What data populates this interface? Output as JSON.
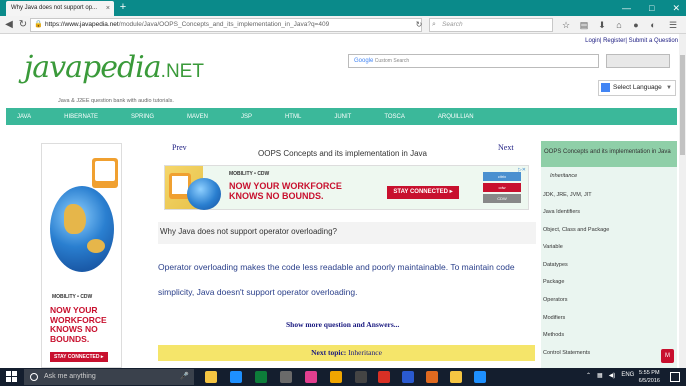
{
  "browser": {
    "tab_title": "Why Java does not support op...",
    "tab_close": "×",
    "new_tab": "+",
    "url_domain": "https://www.javapedia.net",
    "url_path": "/module/Java/OOPS_Concepts_and_its_implementation_in_Java?q=409",
    "search_placeholder": "Search",
    "window_controls": [
      "—",
      "□",
      "✕"
    ]
  },
  "site": {
    "top_links": "Login| Register| Submit a Question",
    "logo_main": "javapedia",
    "logo_net": ".NET",
    "tagline": "Java & J2EE question bank with audio tutorials.",
    "custom_search_placeholder": "Custom Search",
    "google_text": "Google",
    "language": "Select Language",
    "menu": [
      "JAVA",
      "HIBERNATE",
      "SPRING",
      "MAVEN",
      "JSP",
      "HTML",
      "JUNIT",
      "TOSCA",
      "ARQUILLIAN"
    ]
  },
  "content": {
    "prev": "Prev",
    "next": "Next",
    "title": "OOPS Concepts and its implementation in Java",
    "question": "Why Java does not support operator overloading?",
    "answer_line1": "Operator overloading makes the code less readable and poorly maintainable. To maintain code",
    "answer_line2": "simplicity, Java doesn't support operator overloading.",
    "show_more": "Show more question and Answers...",
    "next_topic_label": "Next topic:",
    "next_topic_value": "Inheritance"
  },
  "ads": {
    "brand": "MOBILITY • CDW",
    "top_headline_1": "NOW YOUR WORKFORCE",
    "top_headline_2": "KNOWS NO BOUNDS.",
    "side_headline": [
      "NOW YOUR",
      "WORKFORCE",
      "KNOWS NO",
      "BOUNDS."
    ],
    "cta": "STAY CONNECTED ▸",
    "logos": [
      "citrix",
      "cdw",
      "CDW"
    ]
  },
  "sidebar": {
    "header": "OOPS Concepts and its implementation in Java",
    "current": "Inheritance",
    "items": [
      "JDK, JRE, JVM, JIT",
      "Java Identifiers",
      "Object, Class and Package",
      "Variable",
      "Datatypes",
      "Package",
      "Operators",
      "Modifiers",
      "Methods",
      "Control Statements"
    ]
  },
  "taskbar": {
    "search_placeholder": "Ask me anything",
    "time": "5:55 PM",
    "date": "6/5/2016",
    "colors": [
      "#f5c542",
      "#1e90ff",
      "#0d7d3a",
      "#6a6a6a",
      "#e23f8f",
      "#f0a500",
      "#444444",
      "#d93025",
      "#2a5ad0",
      "#e06a20"
    ]
  }
}
